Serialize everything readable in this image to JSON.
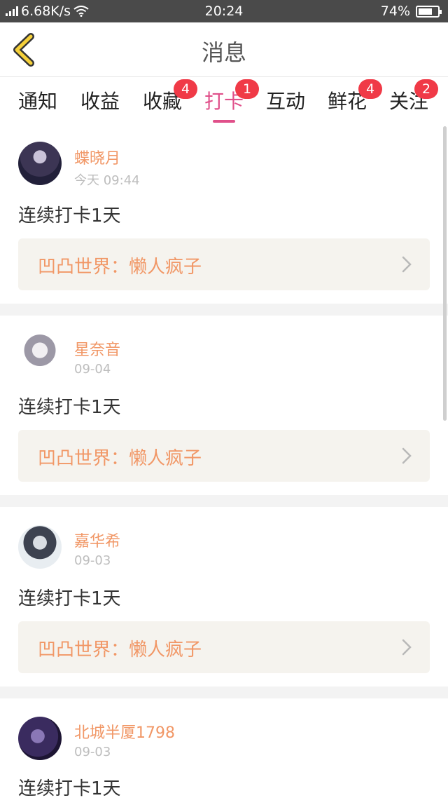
{
  "status_bar": {
    "network": "4G",
    "speed": "6.68K/s",
    "time": "20:24",
    "battery": "74%",
    "battery_level": 0.74
  },
  "header": {
    "title": "消息",
    "back_icon": "chevron-left-icon",
    "accent_color": "#f5d03a"
  },
  "tabs": [
    {
      "label": "通知",
      "badge": "",
      "active": false
    },
    {
      "label": "收益",
      "badge": "",
      "active": false
    },
    {
      "label": "收藏",
      "badge": "4",
      "active": false
    },
    {
      "label": "打卡",
      "badge": "1",
      "active": true
    },
    {
      "label": "互动",
      "badge": "",
      "active": false
    },
    {
      "label": "鲜花",
      "badge": "4",
      "active": false
    },
    {
      "label": "关注",
      "badge": "2",
      "active": false
    }
  ],
  "colors": {
    "active_tab": "#e0508a",
    "badge": "#f03a47",
    "username": "#f19766",
    "link_bg": "#f5f3ee"
  },
  "items": [
    {
      "user": "蝶晓月",
      "time": "今天 09:44",
      "content": "连续打卡1天",
      "link": "凹凸世界：懒人疯子"
    },
    {
      "user": "星奈音",
      "time": "09-04",
      "content": "连续打卡1天",
      "link": "凹凸世界：懒人疯子"
    },
    {
      "user": "嘉华希",
      "time": "09-03",
      "content": "连续打卡1天",
      "link": "凹凸世界：懒人疯子"
    },
    {
      "user": "北城半厦1798",
      "time": "09-03",
      "content": "连续打卡1天"
    }
  ]
}
